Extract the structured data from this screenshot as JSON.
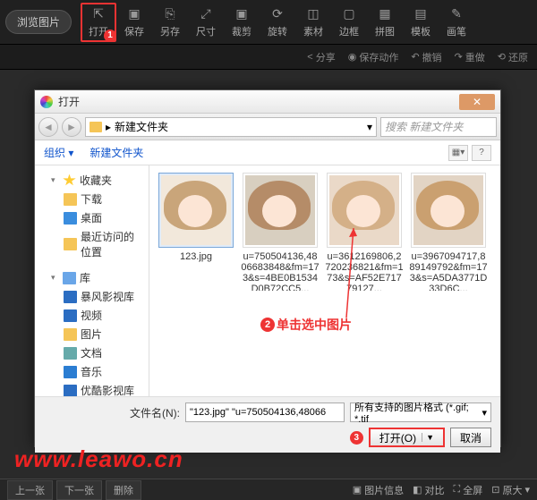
{
  "toolbar": {
    "browse": "浏览图片",
    "items": [
      {
        "label": "打开",
        "icon": "open-icon"
      },
      {
        "label": "保存",
        "icon": "save-icon"
      },
      {
        "label": "另存",
        "icon": "saveas-icon"
      },
      {
        "label": "尺寸",
        "icon": "size-icon"
      },
      {
        "label": "裁剪",
        "icon": "crop-icon"
      },
      {
        "label": "旋转",
        "icon": "rotate-icon"
      },
      {
        "label": "素材",
        "icon": "asset-icon"
      },
      {
        "label": "边框",
        "icon": "border-icon"
      },
      {
        "label": "拼图",
        "icon": "collage-icon"
      },
      {
        "label": "模板",
        "icon": "template-icon"
      },
      {
        "label": "画笔",
        "icon": "brush-icon"
      }
    ],
    "badge1": "1"
  },
  "subbar": {
    "share": "分享",
    "saveaction": "保存动作",
    "undo": "撤销",
    "redo": "重做",
    "restore": "还原"
  },
  "dialog": {
    "title": "打开",
    "crumb": "新建文件夹",
    "search_placeholder": "搜索 新建文件夹",
    "org": "组织",
    "newfolder": "新建文件夹",
    "tree": {
      "fav": "收藏夹",
      "dl": "下载",
      "desk": "桌面",
      "recent": "最近访问的位置",
      "lib": "库",
      "bf": "暴风影视库",
      "vid": "视频",
      "pic": "图片",
      "doc": "文档",
      "mus": "音乐",
      "yk": "优酷影视库"
    },
    "files": [
      {
        "name": "123.jpg"
      },
      {
        "name": "u=750504136,4806683848&fm=173&s=4BE0B1534D0B72CC5..."
      },
      {
        "name": "u=3612169806,2720236821&fm=173&s=AF52E71779127..."
      },
      {
        "name": "u=3967094717,889149792&fm=173&s=A5DA3771D33D6C..."
      }
    ],
    "annot": {
      "num": "2",
      "text": "单击选中图片"
    },
    "fname_label": "文件名(N):",
    "fname_value": "\"123.jpg\" \"u=750504136,48066",
    "filter": "所有支持的图片格式 (*.gif; *.tif",
    "open_btn": "打开(O)",
    "cancel_btn": "取消",
    "badge3": "3"
  },
  "watermark": "www.leawo.cn",
  "bottom": {
    "prev": "上一张",
    "next": "下一张",
    "del": "删除",
    "info": "图片信息",
    "compare": "对比",
    "full": "全屏",
    "orig": "原大"
  }
}
